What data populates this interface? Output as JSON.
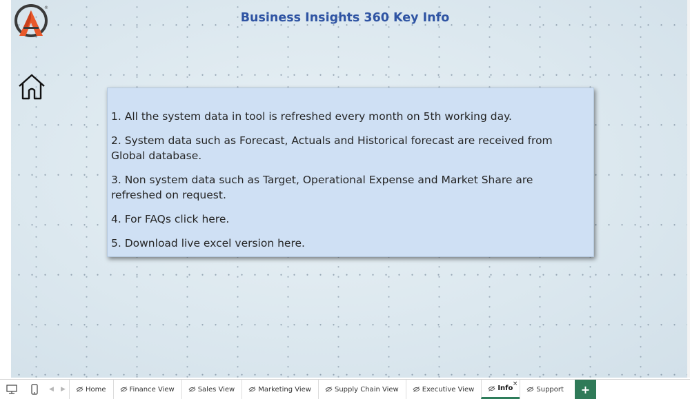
{
  "report": {
    "title": "Business Insights 360 Key Info",
    "items": [
      "1. All the system data in tool is refreshed every month on 5th working day.",
      "2.  System data such as Forecast, Actuals and Historical forecast are received from Global database.",
      "3.  Non system data such as Target, Operational Expense and Market Share are refreshed on request.",
      "4. For FAQs click here.",
      "5. Download live excel version here."
    ],
    "logo_icon": "atliq-logo-icon",
    "home_icon": "home-icon"
  },
  "tabs": [
    {
      "label": "Home",
      "hidden": true,
      "active": false
    },
    {
      "label": "Finance View",
      "hidden": true,
      "active": false
    },
    {
      "label": "Sales View",
      "hidden": true,
      "active": false
    },
    {
      "label": "Marketing View",
      "hidden": true,
      "active": false
    },
    {
      "label": "Supply Chain View",
      "hidden": true,
      "active": false
    },
    {
      "label": "Executive View",
      "hidden": true,
      "active": false
    },
    {
      "label": "Info",
      "hidden": true,
      "active": true
    },
    {
      "label": "Support",
      "hidden": true,
      "active": false
    }
  ],
  "tabbar": {
    "add_label": "+",
    "close_label": "×",
    "prev_label": "◀",
    "next_label": "▶"
  },
  "colors": {
    "title": "#2f54a3",
    "card_bg": "#cfe0f4",
    "active_tab": "#2e7d5b",
    "add_button": "#2f7a58",
    "logo_orange": "#e8582a",
    "logo_dark": "#3a3a3a"
  }
}
